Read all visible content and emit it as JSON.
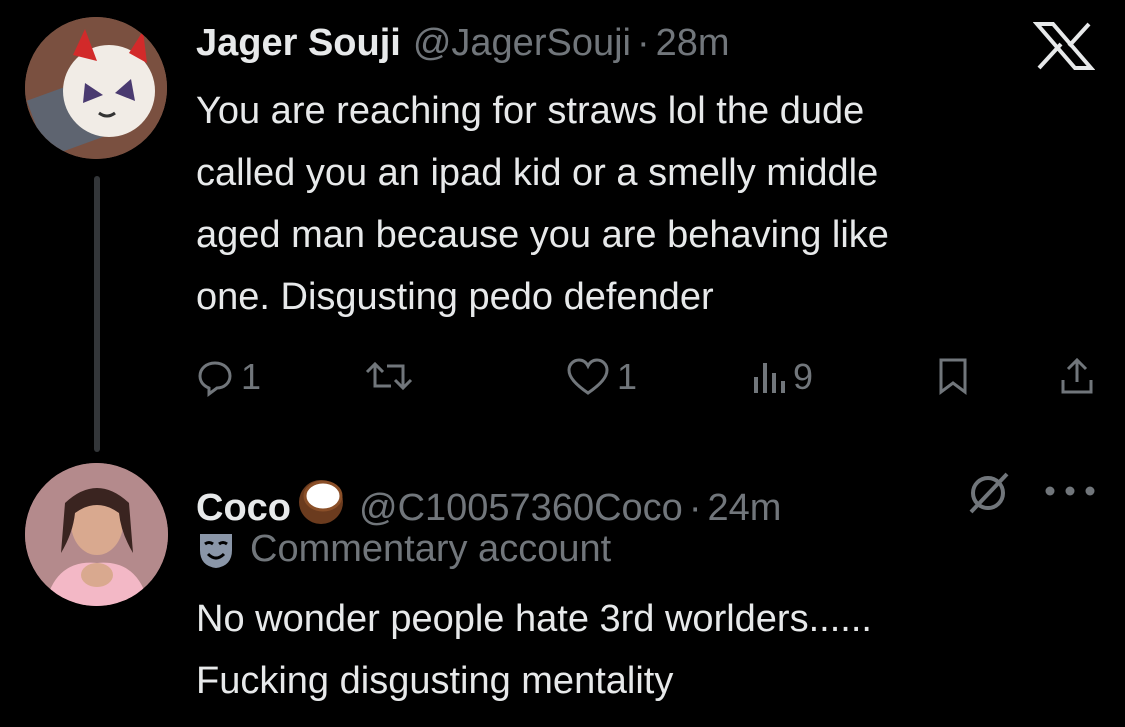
{
  "tweets": [
    {
      "display_name": "Jager Souji",
      "handle": "@JagerSouji",
      "separator": "·",
      "time": "28m",
      "text": "You are reaching for straws lol the dude\ncalled you an ipad kid or a smelly middle\naged man because you are behaving like\none. Disgusting pedo defender",
      "avatar_icon": "avatar-mascot",
      "brand_icon": "x-logo-icon",
      "actions": {
        "replies": "1",
        "retweets": "",
        "likes": "1",
        "views": "9"
      }
    },
    {
      "display_name": "Coco",
      "name_emoji": "coconut-emoji",
      "handle": "@C10057360Coco",
      "separator": "·",
      "time": "24m",
      "label": "Commentary account",
      "label_icon": "theater-mask-icon",
      "text": "No wonder people hate 3rd worlders......\nFucking disgusting mentality",
      "avatar_icon": "avatar-photo"
    }
  ],
  "colors": {
    "background": "#000000",
    "primary_text": "#e7e9ea",
    "secondary_text": "#71767b",
    "thread_line": "#333639"
  }
}
